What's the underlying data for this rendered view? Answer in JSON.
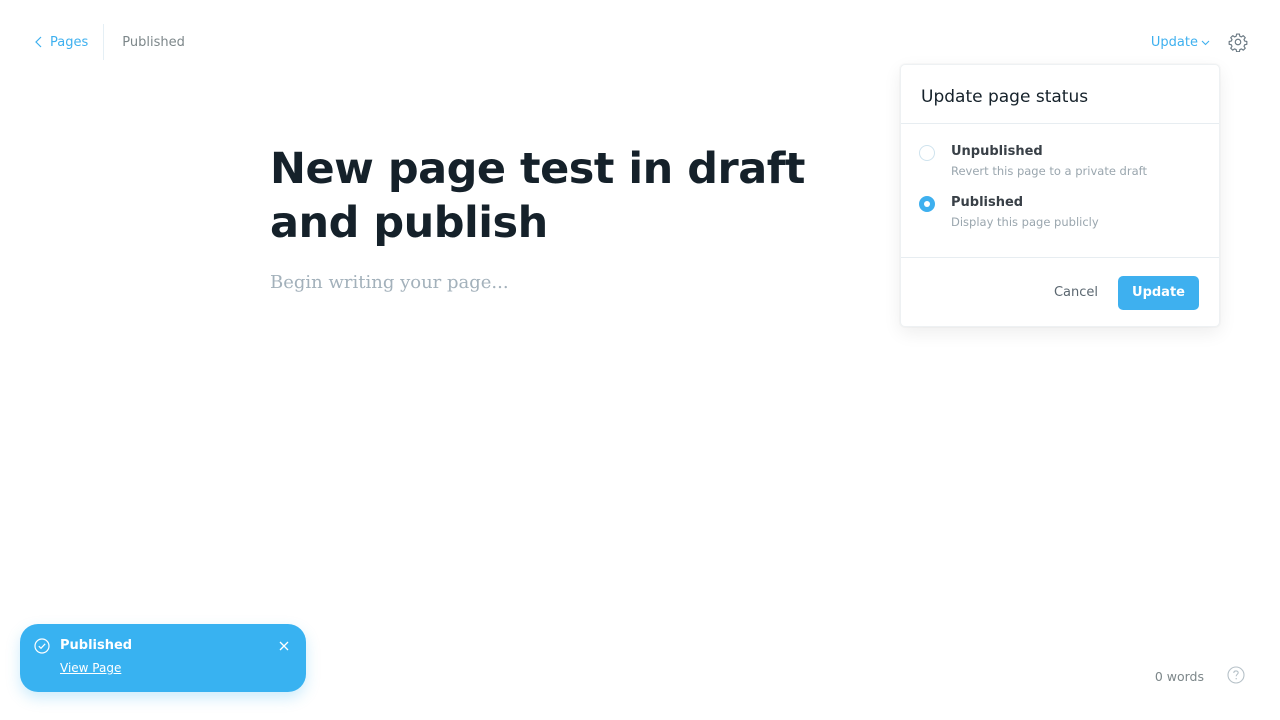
{
  "header": {
    "back_label": "Pages",
    "status_label": "Published",
    "update_trigger_label": "Update"
  },
  "editor": {
    "title": "New page test in draft and publish",
    "placeholder": "Begin writing your page..."
  },
  "status_dropdown": {
    "title": "Update page status",
    "options": [
      {
        "label": "Unpublished",
        "description": "Revert this page to a private draft",
        "selected": false
      },
      {
        "label": "Published",
        "description": "Display this page publicly",
        "selected": true
      }
    ],
    "cancel_label": "Cancel",
    "confirm_label": "Update"
  },
  "toast": {
    "title": "Published",
    "link_label": "View Page"
  },
  "footer": {
    "word_count": "0 words"
  },
  "colors": {
    "accent": "#3eb0ef",
    "toast_bg": "#38b2f1",
    "text": "#15212a",
    "muted": "#7d878a"
  }
}
